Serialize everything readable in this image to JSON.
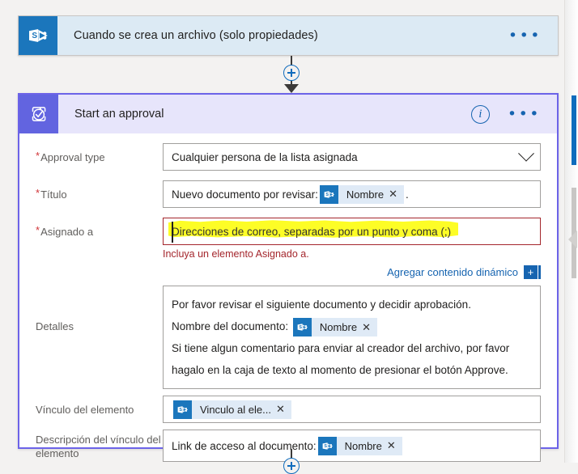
{
  "flow": {
    "trigger": {
      "title": "Cuando se crea un archivo (solo propiedades)",
      "connector_icon": "sharepoint-icon",
      "more_menu": "•••"
    },
    "connector": {
      "add_label": "+",
      "add_icon": "plus-circle-icon",
      "arrow_icon": "arrow-down-icon"
    },
    "action": {
      "title": "Start an approval",
      "connector_icon": "approval-icon",
      "info_label": "i",
      "more_menu": "•••",
      "fields": {
        "approval_type": {
          "label": "Approval type",
          "required_marker": "*",
          "value": "Cualquier persona de la lista asignada",
          "chevron_icon": "chevron-down-icon"
        },
        "titulo": {
          "label": "Título",
          "required_marker": "*",
          "prefix_text": "Nuevo documento por revisar:",
          "token": {
            "icon": "sharepoint-icon",
            "text": "Nombre",
            "remove": "✕"
          },
          "suffix_text": "."
        },
        "asignado_a": {
          "label": "Asignado a",
          "required_marker": "*",
          "placeholder": "Direcciones de correo, separadas por un punto y coma (;)",
          "value": "",
          "error_message": "Incluya un elemento Asignado a.",
          "highlight_color": "#fdfd26",
          "error_color": "#a4262c"
        },
        "dynamic_content": {
          "link_label": "Agregar contenido dinámico",
          "button_label": "+"
        },
        "detalles": {
          "label": "Detalles",
          "line1": "Por favor revisar el siguiente documento y decidir aprobación.",
          "line2_prefix": "Nombre del documento:",
          "line2_token": {
            "icon": "sharepoint-icon",
            "text": "Nombre",
            "remove": "✕"
          },
          "line3": "Si tiene algun comentario para enviar al creador del archivo, por favor",
          "line4": "hagalo en la caja de texto al momento de presionar el botón Approve."
        },
        "vinculo_elemento": {
          "label": "Vínculo del elemento",
          "token": {
            "icon": "sharepoint-icon",
            "text": "Vinculo al ele...",
            "remove": "✕"
          }
        },
        "descripcion_vinculo": {
          "label": "Descripción del vínculo del elemento",
          "prefix_text": "Link de acceso al documento:",
          "token": {
            "icon": "sharepoint-icon",
            "text": "Nombre",
            "remove": "✕"
          }
        }
      }
    }
  },
  "theme": {
    "trigger_header_bg": "#dceaf4",
    "sharepoint_blue": "#1b76bc",
    "action_header_bg": "#e7e5fb",
    "approval_purple": "#6264e0",
    "link_blue": "#1664b0",
    "canvas_bg": "#f3f2f1"
  }
}
